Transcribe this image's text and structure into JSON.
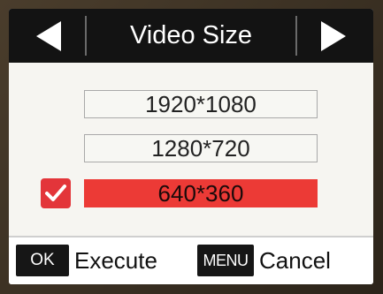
{
  "header": {
    "title": "Video Size",
    "prev_icon": "triangle-left-icon",
    "next_icon": "triangle-right-icon"
  },
  "options": [
    {
      "label": "1920*1080",
      "selected": false
    },
    {
      "label": "1280*720",
      "selected": false
    },
    {
      "label": "640*360",
      "selected": true
    }
  ],
  "footer": {
    "ok_key": "OK",
    "ok_action": "Execute",
    "menu_key": "MENU",
    "menu_action": "Cancel"
  },
  "colors": {
    "header_bg": "#131313",
    "selected_bg": "#ec3a36",
    "checkbox_bg": "#e3353a",
    "screen_bg": "#f6f5f1"
  }
}
